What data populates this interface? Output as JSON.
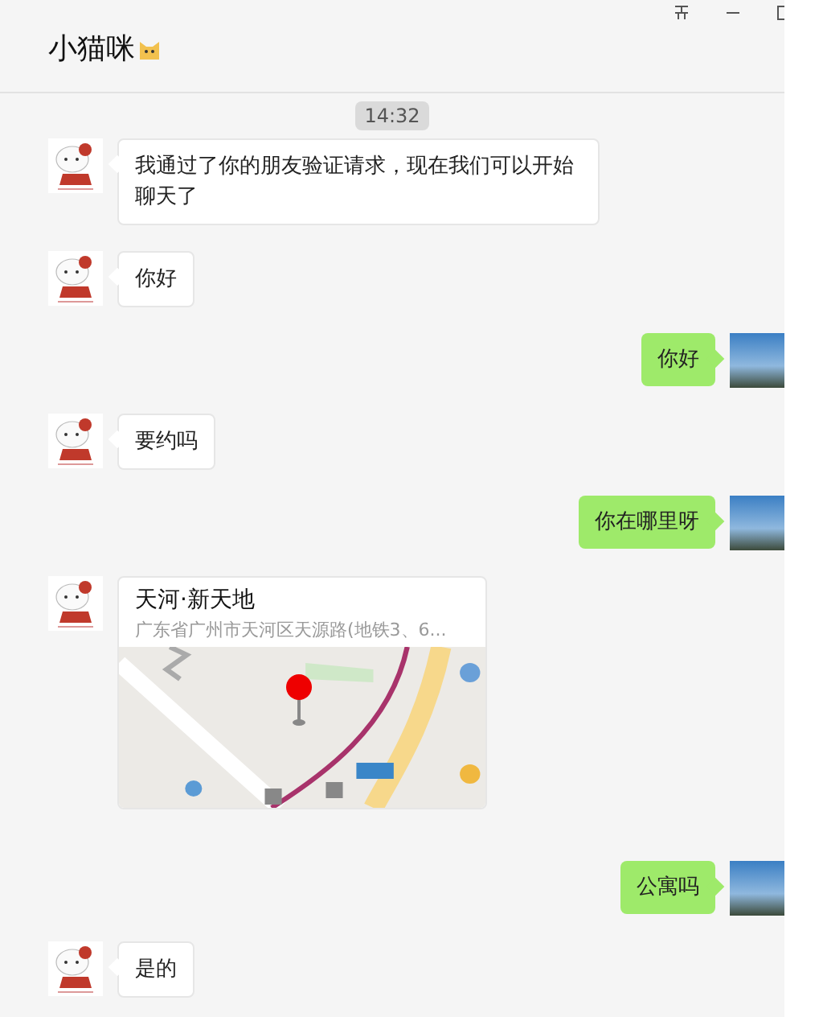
{
  "window": {
    "title": "小猫咪"
  },
  "timestamp": "14:32",
  "messages": [
    {
      "kind": "text",
      "outgoing": false,
      "text": "我通过了你的朋友验证请求，现在我们可以开始聊天了"
    },
    {
      "kind": "text",
      "outgoing": false,
      "text": "你好"
    },
    {
      "kind": "text",
      "outgoing": true,
      "text": "你好"
    },
    {
      "kind": "text",
      "outgoing": false,
      "text": "要约吗"
    },
    {
      "kind": "text",
      "outgoing": true,
      "text": "你在哪里呀"
    },
    {
      "kind": "location",
      "outgoing": false,
      "title": "天河·新天地",
      "address": "广东省广州市天河区天源路(地铁3、6..."
    },
    {
      "kind": "text",
      "outgoing": true,
      "text": "公寓吗"
    },
    {
      "kind": "text",
      "outgoing": false,
      "text": "是的"
    }
  ]
}
